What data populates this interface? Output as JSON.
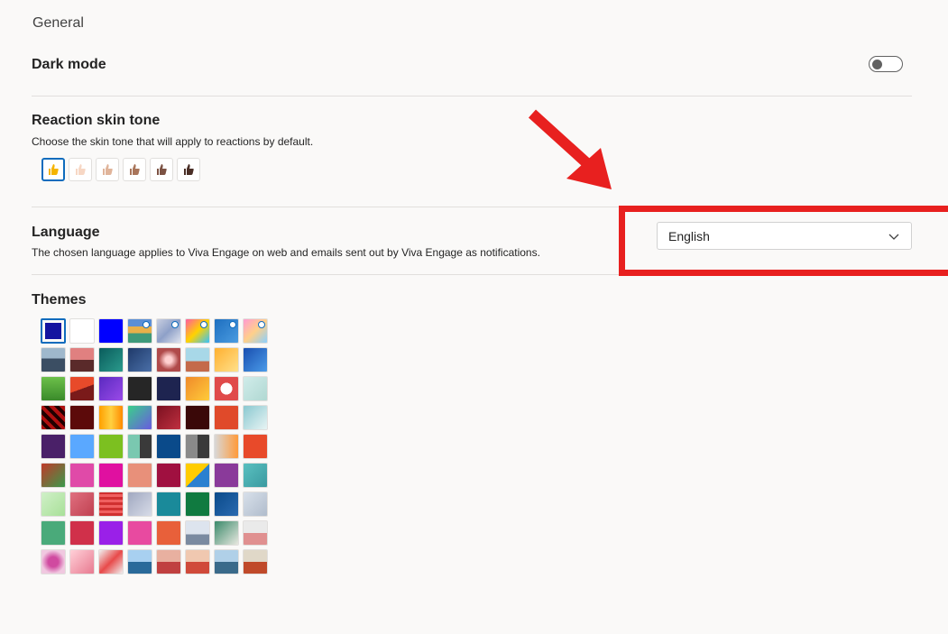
{
  "general": {
    "section_title": "General",
    "dark_mode": {
      "label": "Dark mode",
      "enabled": false
    },
    "reaction_skin_tone": {
      "title": "Reaction skin tone",
      "description": "Choose the skin tone that will apply to reactions by default.",
      "tones": [
        {
          "name": "default",
          "color": "#f5b400"
        },
        {
          "name": "light",
          "color": "#f7d7c4"
        },
        {
          "name": "medium-light",
          "color": "#e0b49a"
        },
        {
          "name": "medium",
          "color": "#a9755a"
        },
        {
          "name": "medium-dark",
          "color": "#7c5243"
        },
        {
          "name": "dark",
          "color": "#4a2e26"
        }
      ],
      "selected_index": 0
    },
    "language": {
      "title": "Language",
      "description": "The chosen language applies to Viva Engage on web and emails sent out by Viva Engage as notifications.",
      "selected": "English"
    },
    "themes": {
      "title": "Themes",
      "selected_index": 0,
      "swatches": [
        {
          "bg": "#1414a0"
        },
        {
          "bg": "#ffffff"
        },
        {
          "bg": "#0000ff"
        },
        {
          "bg": "linear-gradient(180deg,#5b8fd6 0 30%,#e8b04a 30% 60%,#3f9a7a 60%)",
          "star": true
        },
        {
          "bg": "linear-gradient(135deg,#c9cfe0,#8ea0c8,#dfe3ee)",
          "star": true
        },
        {
          "bg": "linear-gradient(135deg,#ff5ba0,#ffd200,#35c2ff)",
          "star": true
        },
        {
          "bg": "linear-gradient(135deg,#1e6fc0,#4a9be0)",
          "star": true
        },
        {
          "bg": "linear-gradient(135deg,#ff9bd2,#ffd08a,#8ad0ff)",
          "star": true
        },
        {
          "bg": "linear-gradient(180deg,#9fb8cc 0 45%,#3b4e63 45%)"
        },
        {
          "bg": "linear-gradient(180deg,#e08080 0 50%,#5a2a2a 50%)"
        },
        {
          "bg": "linear-gradient(135deg,#0a5c5c,#2a9a8c)"
        },
        {
          "bg": "linear-gradient(135deg,#1f3a6a,#4a6fa8)"
        },
        {
          "bg": "radial-gradient(circle,#ffd0d0 0 20%,#b04a4a 60%)"
        },
        {
          "bg": "linear-gradient(180deg,#a8d8e8 0 55%,#c46a4a 55%)"
        },
        {
          "bg": "linear-gradient(135deg,#ffb030,#ffe08a)"
        },
        {
          "bg": "linear-gradient(135deg,#1a4fb0,#4a9be8)"
        },
        {
          "bg": "linear-gradient(180deg,#6cc04a,#3a8a2a)"
        },
        {
          "bg": "linear-gradient(160deg,#e84a2a 0 50%,#7a1a1a 50%)"
        },
        {
          "bg": "linear-gradient(135deg,#5a2ac0,#9a4ae8)"
        },
        {
          "bg": "#262626"
        },
        {
          "bg": "#1e2450"
        },
        {
          "bg": "linear-gradient(135deg,#f08a2a,#ffcc3a)"
        },
        {
          "bg": "radial-gradient(circle,#ffffff 0 35%,#e04a4a 36%)"
        },
        {
          "bg": "linear-gradient(135deg,#d0ecea,#b0d8d2)"
        },
        {
          "bg": "repeating-linear-gradient(45deg,#b01010 0 4px,#200000 4px 8px)"
        },
        {
          "bg": "#5c0a0a"
        },
        {
          "bg": "linear-gradient(90deg,#ffa000,#ffd040,#ff8a00)"
        },
        {
          "bg": "linear-gradient(135deg,#3ad08a,#6a5ae0)"
        },
        {
          "bg": "linear-gradient(135deg,#7a1020,#c03040)"
        },
        {
          "bg": "#3a0808"
        },
        {
          "bg": "#e04a2a"
        },
        {
          "bg": "linear-gradient(135deg,#8ac8d0,#e8f4f4)"
        },
        {
          "bg": "#4a2068"
        },
        {
          "bg": "#5aa8ff"
        },
        {
          "bg": "#7cc020"
        },
        {
          "bg": "linear-gradient(90deg,#7ac8b0 0 50%,#3a3a3a 50%)"
        },
        {
          "bg": "#0a4a8a"
        },
        {
          "bg": "linear-gradient(90deg,#8a8a8a 0 50%,#3a3a3a 50%)"
        },
        {
          "bg": "linear-gradient(90deg,#d8d8d8,#ff9a3a)"
        },
        {
          "bg": "#e84a2a"
        },
        {
          "bg": "linear-gradient(135deg,#c03a2a,#3a9a4a)"
        },
        {
          "bg": "#e04aa8"
        },
        {
          "bg": "#e010a0"
        },
        {
          "bg": "#e8907a"
        },
        {
          "bg": "#a01040"
        },
        {
          "bg": "linear-gradient(135deg,#ffcc00 0 50%,#2a80d0 50%)"
        },
        {
          "bg": "#8a3a9a"
        },
        {
          "bg": "linear-gradient(135deg,#5ac0c0,#3a9aa0)"
        },
        {
          "bg": "linear-gradient(135deg,#d0f0c8,#a8e098)"
        },
        {
          "bg": "linear-gradient(135deg,#e07080,#c04050)"
        },
        {
          "bg": "repeating-linear-gradient(0deg,#d03030 0 3px,#f06060 3px 6px)"
        },
        {
          "bg": "linear-gradient(135deg,#a0a8c0,#d8dce8)"
        },
        {
          "bg": "#1a8a9a"
        },
        {
          "bg": "#107a40"
        },
        {
          "bg": "linear-gradient(135deg,#0a4a8a,#2a6ab0)"
        },
        {
          "bg": "linear-gradient(135deg,#d8e0ea,#b0bccc)"
        },
        {
          "bg": "#4aaa7a"
        },
        {
          "bg": "#d0304a"
        },
        {
          "bg": "#9a20e8"
        },
        {
          "bg": "#e84aa0"
        },
        {
          "bg": "#e8603a"
        },
        {
          "bg": "linear-gradient(180deg,#dde4ee 0 55%,#7a8aa0 55%)"
        },
        {
          "bg": "linear-gradient(135deg,#3a8a6a,#e8e8e0)"
        },
        {
          "bg": "linear-gradient(180deg,#eaeaea 0 50%,#e09090 50%)"
        },
        {
          "bg": "radial-gradient(circle,#d04aa0 0 30%,#f0c8e0 70%)"
        },
        {
          "bg": "linear-gradient(135deg,#ffd0d8,#e87a90)"
        },
        {
          "bg": "linear-gradient(135deg,#f0f0f0,#e84a4a,#f0f0f0)"
        },
        {
          "bg": "linear-gradient(180deg,#a8d0f0 0 50%,#2a6a9a 50%)"
        },
        {
          "bg": "linear-gradient(180deg,#e8b0a0 0 50%,#c04040 50%)"
        },
        {
          "bg": "linear-gradient(180deg,#f0c8b0 0 50%,#d04a3a 50%)"
        },
        {
          "bg": "linear-gradient(180deg,#b0d0e8 0 50%,#3a6a8a 50%)"
        },
        {
          "bg": "linear-gradient(180deg,#e0d8c8 0 50%,#c04a2a 50%)"
        }
      ]
    }
  }
}
